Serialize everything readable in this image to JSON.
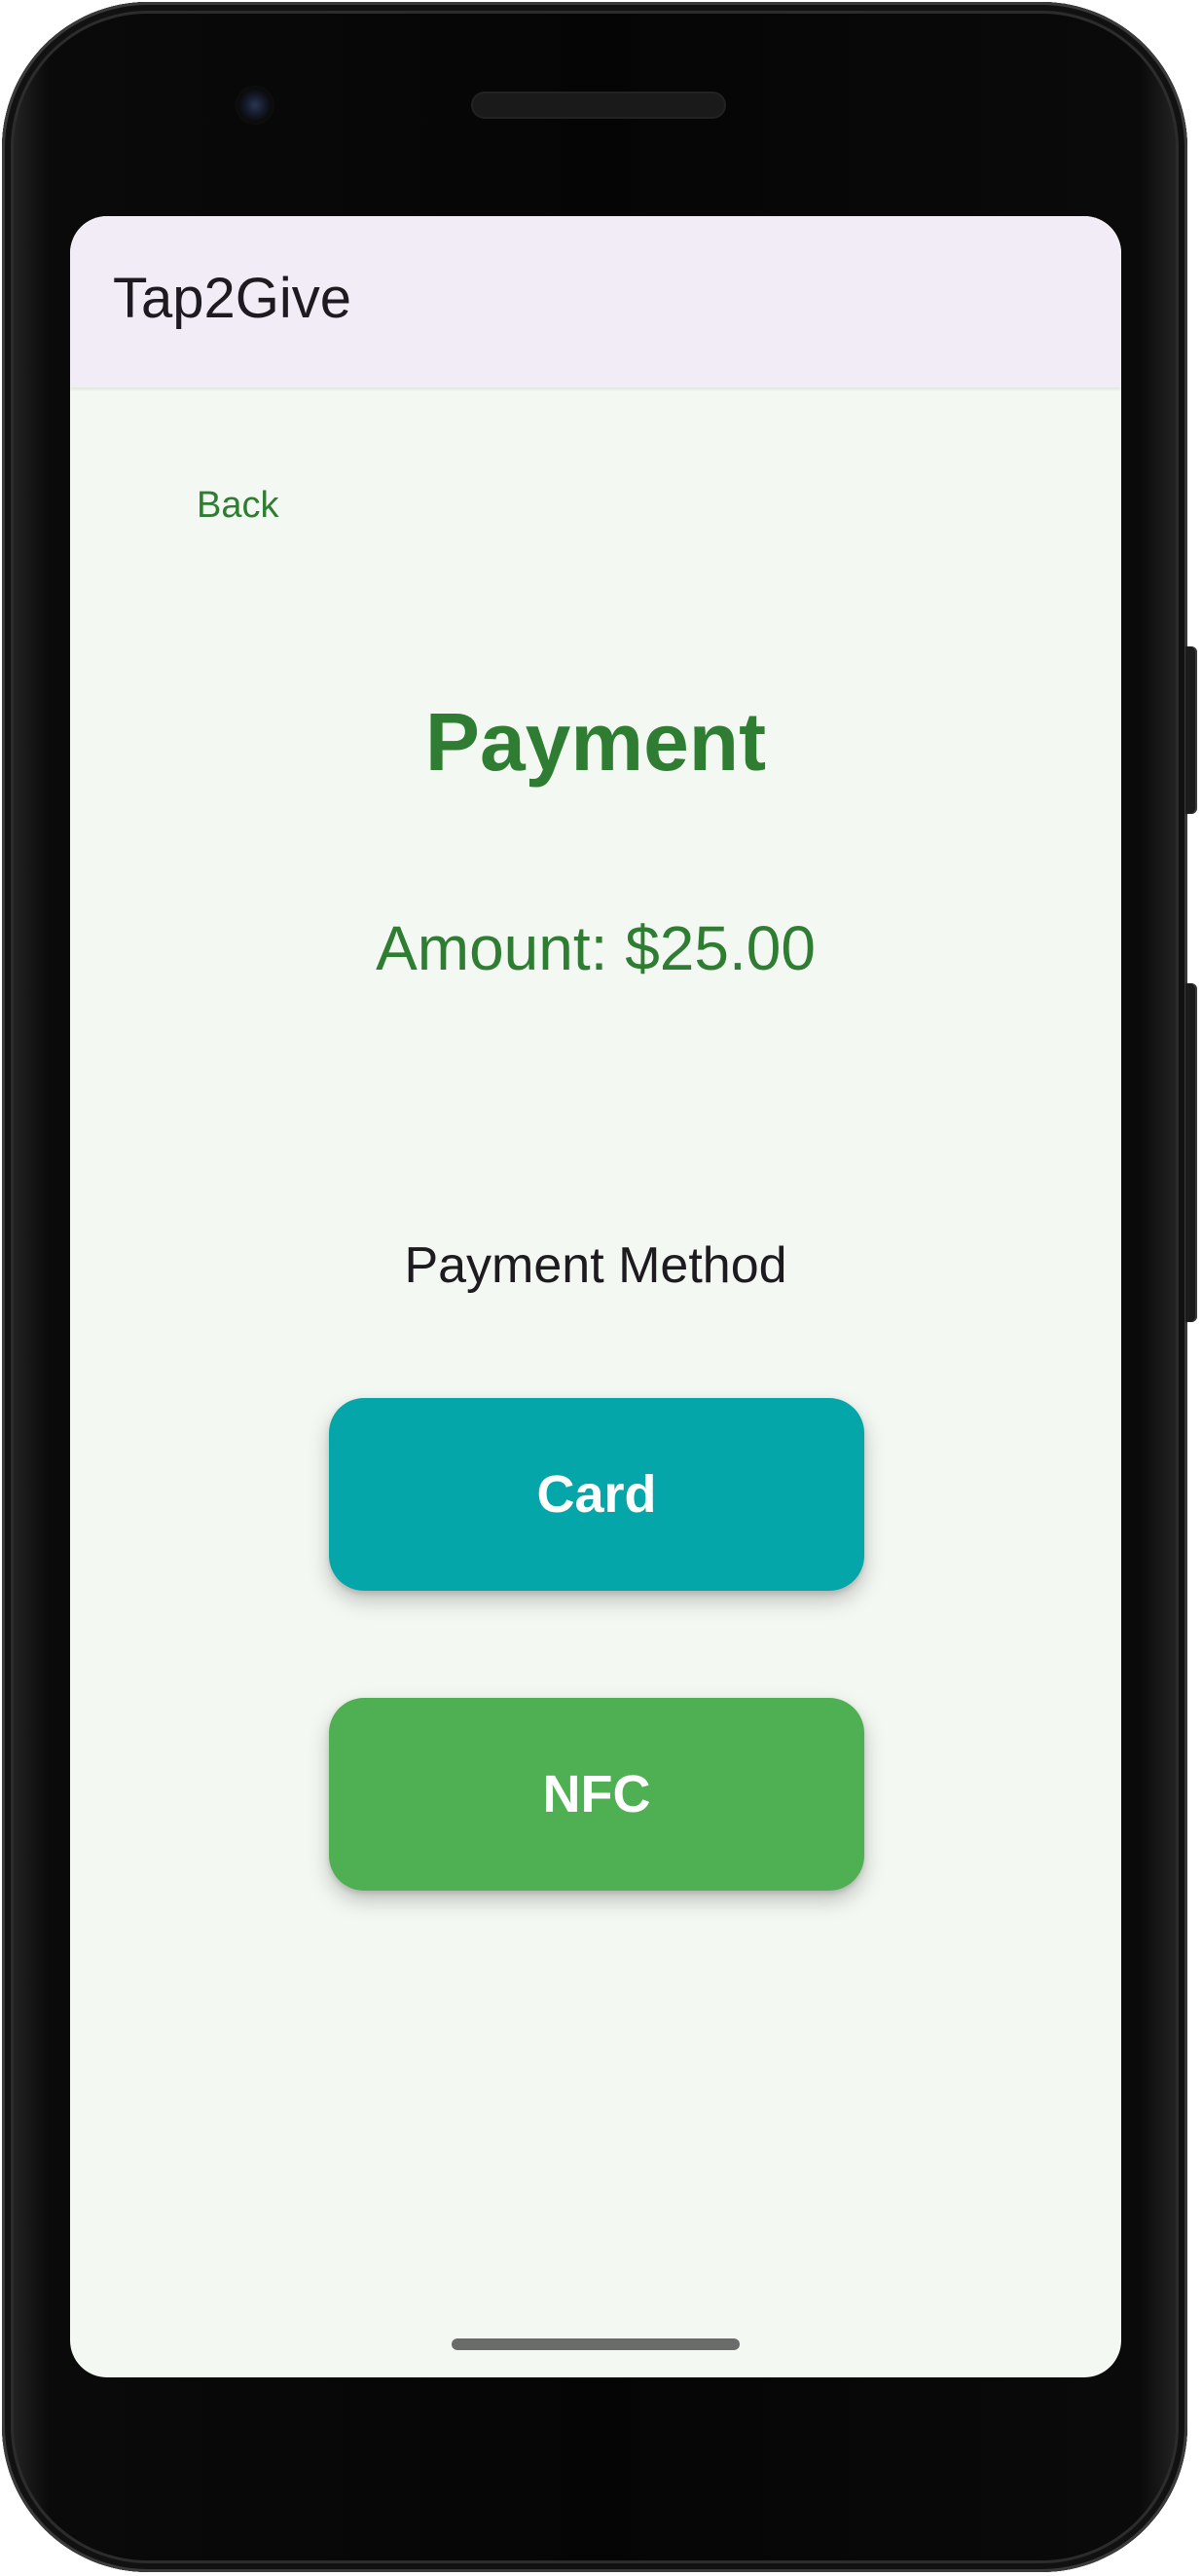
{
  "app_bar": {
    "title": "Tap2Give"
  },
  "navigation": {
    "back_label": "Back"
  },
  "payment": {
    "title": "Payment",
    "amount_text": "Amount: $25.00",
    "method_label": "Payment Method",
    "methods": [
      {
        "label": "Card",
        "color": "#04a6a9"
      },
      {
        "label": "NFC",
        "color": "#4eb052"
      }
    ]
  },
  "colors": {
    "accent_green": "#2e7d32",
    "app_bar_bg": "#f2ecf6",
    "screen_bg": "#f4f8f2"
  }
}
